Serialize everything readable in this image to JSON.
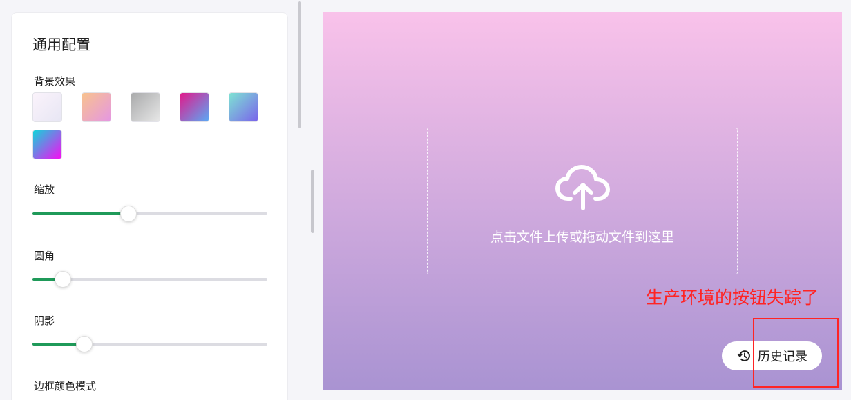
{
  "config_panel": {
    "title": "通用配置",
    "background_effect": {
      "label": "背景效果",
      "swatches": [
        {
          "name": "soft-lilac",
          "gradient": [
            "#fbf3fb",
            "#e7e6f4"
          ]
        },
        {
          "name": "peach-pink",
          "gradient": [
            "#f8c28e",
            "#e597e2"
          ]
        },
        {
          "name": "gray",
          "gradient": [
            "#a9aaab",
            "#e7e7e7"
          ]
        },
        {
          "name": "magenta-blue",
          "gradient": [
            "#e11a8b",
            "#5aa9f5"
          ]
        },
        {
          "name": "mint-violet",
          "gradient": [
            "#7ee3d3",
            "#7a63eb"
          ]
        },
        {
          "name": "cyan-magenta",
          "gradient": [
            "#10d6da",
            "#f80cf3"
          ]
        }
      ]
    },
    "zoom": {
      "label": "缩放",
      "value": 0.41
    },
    "radius": {
      "label": "圆角",
      "value": 0.13
    },
    "shadow": {
      "label": "阴影",
      "value": 0.22
    },
    "border_color_mode": {
      "label": "边框颜色模式"
    }
  },
  "preview": {
    "background": [
      "#f9c2ea",
      "#a993d2"
    ],
    "dropzone_text": "点击文件上传或拖动文件到这里",
    "upload_icon": "cloud-upload-icon",
    "history_button": {
      "label": "历史记录",
      "icon": "history-icon"
    }
  },
  "annotation": {
    "text": "生产环境的按钮失踪了",
    "color": "#ff2424"
  }
}
